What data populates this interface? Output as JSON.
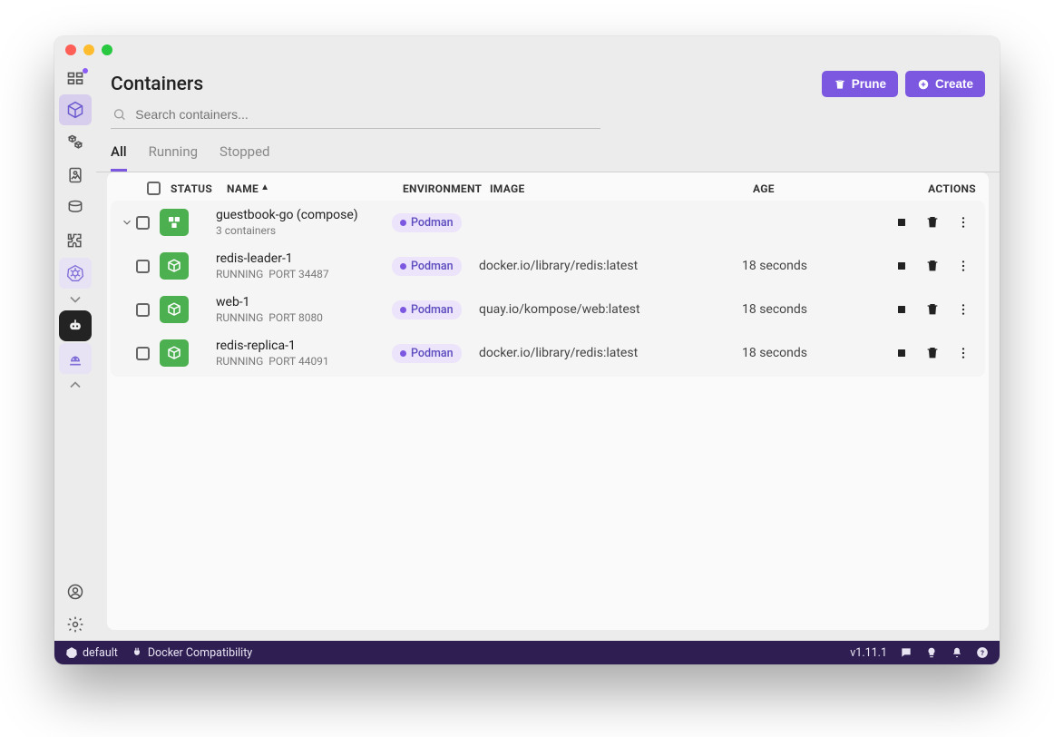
{
  "header": {
    "title": "Containers",
    "prune_label": "Prune",
    "create_label": "Create"
  },
  "search": {
    "placeholder": "Search containers..."
  },
  "tabs": {
    "all": "All",
    "running": "Running",
    "stopped": "Stopped",
    "active": "All"
  },
  "columns": {
    "status": "STATUS",
    "name": "NAME",
    "environment": "ENVIRONMENT",
    "image": "IMAGE",
    "age": "AGE",
    "actions": "ACTIONS"
  },
  "env_label": "Podman",
  "rows": [
    {
      "type": "compose",
      "name": "guestbook-go (compose)",
      "sub": "3 containers",
      "image": "",
      "age": ""
    },
    {
      "type": "container",
      "name": "redis-leader-1",
      "state": "RUNNING",
      "port": "PORT 34487",
      "image": "docker.io/library/redis:latest",
      "age": "18 seconds"
    },
    {
      "type": "container",
      "name": "web-1",
      "state": "RUNNING",
      "port": "PORT 8080",
      "image": "quay.io/kompose/web:latest",
      "age": "18 seconds"
    },
    {
      "type": "container",
      "name": "redis-replica-1",
      "state": "RUNNING",
      "port": "PORT 44091",
      "image": "docker.io/library/redis:latest",
      "age": "18 seconds"
    }
  ],
  "statusbar": {
    "context": "default",
    "docker_compat": "Docker Compatibility",
    "version": "v1.11.1"
  },
  "colors": {
    "accent": "#7c58e0",
    "running": "#4caf50",
    "statusbar": "#2f1e52"
  }
}
